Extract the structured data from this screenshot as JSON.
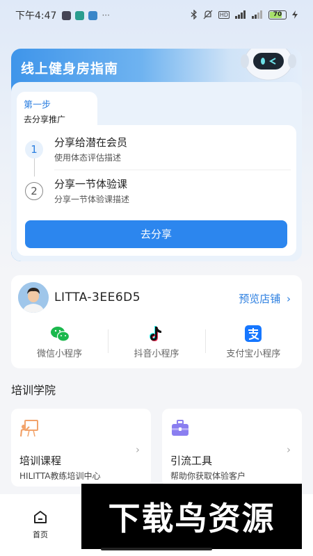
{
  "status_bar": {
    "time": "下午4:47",
    "battery": "70",
    "network": "HD"
  },
  "guide": {
    "title": "线上健身房指南",
    "step_tab": {
      "title": "第一步",
      "subtitle": "去分享推广"
    },
    "steps": [
      {
        "number": "1",
        "title": "分享给潜在会员",
        "desc": "使用体态评估描述"
      },
      {
        "number": "2",
        "title": "分享一节体验课",
        "desc": "分享一节体验课描述"
      }
    ],
    "share_button": "去分享"
  },
  "shop": {
    "name": "LITTA-3EE6D5",
    "preview_link": "预览店铺",
    "chevron": "›",
    "mini_programs": [
      {
        "label": "微信小程序",
        "icon": "wechat-icon"
      },
      {
        "label": "抖音小程序",
        "icon": "douyin-icon"
      },
      {
        "label": "支付宝小程序",
        "icon": "alipay-icon"
      }
    ]
  },
  "training": {
    "section_title": "培训学院",
    "cards": [
      {
        "title": "培训课程",
        "desc": "HILITTA教练培训中心",
        "icon": "trainer-board-icon",
        "chevron": "›"
      },
      {
        "title": "引流工具",
        "desc": "帮助你获取体验客户",
        "icon": "toolbox-icon",
        "chevron": "›"
      }
    ]
  },
  "bottom_nav": {
    "home_label": "首页"
  },
  "watermark": {
    "text": "下载鸟资源"
  },
  "colors": {
    "accent": "#2c86ee",
    "link": "#2c7fe0",
    "guide_gradient_start": "#3f95ea"
  }
}
